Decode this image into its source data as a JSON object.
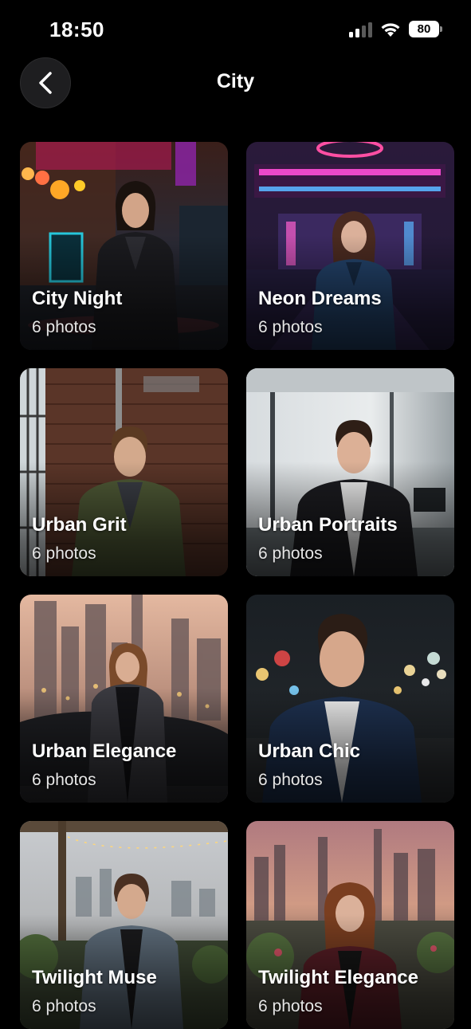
{
  "status_bar": {
    "time": "18:50",
    "battery": "80"
  },
  "header": {
    "title": "City"
  },
  "albums": [
    {
      "title": "City Night",
      "subtitle": "6 photos",
      "theme": "neon-street"
    },
    {
      "title": "Neon Dreams",
      "subtitle": "6 photos",
      "theme": "neon-arcade"
    },
    {
      "title": "Urban Grit",
      "subtitle": "6 photos",
      "theme": "brick-loft"
    },
    {
      "title": "Urban Portraits",
      "subtitle": "6 photos",
      "theme": "office-glass"
    },
    {
      "title": "Urban Elegance",
      "subtitle": "6 photos",
      "theme": "skyline-dusk"
    },
    {
      "title": "Urban Chic",
      "subtitle": "6 photos",
      "theme": "bokeh-night"
    },
    {
      "title": "Twilight Muse",
      "subtitle": "6 photos",
      "theme": "rooftop-pergola"
    },
    {
      "title": "Twilight Elegance",
      "subtitle": "6 photos",
      "theme": "rooftop-garden"
    }
  ],
  "colors": {
    "background": "#000000",
    "back_button_bg": "#1e1e20",
    "text": "#ffffff"
  }
}
